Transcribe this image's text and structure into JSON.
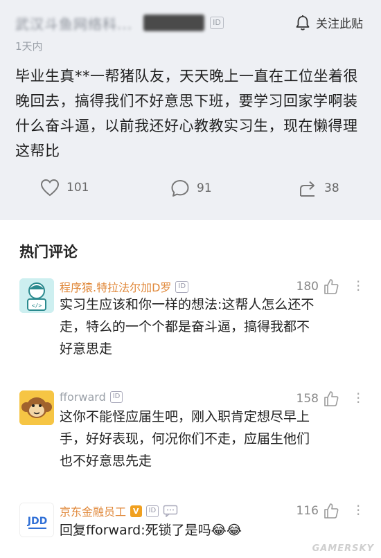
{
  "post": {
    "author_name": "武汉斗鱼网络科...",
    "author_badge": "",
    "id_label": "ID",
    "follow_label": "关注此贴",
    "time": "1天内",
    "body": "毕业生真**一帮猪队友，天天晚上一直在工位坐着很晚回去，搞得我们不好意思下班，要学习回家学啊装什么奋斗逼，以前我还好心教教实习生，现在懒得理这帮比",
    "likes": "101",
    "comments": "91",
    "shares": "38"
  },
  "section_title": "热门评论",
  "comments": [
    {
      "name": "程序猿.特拉法尔加D罗",
      "name_color": "#e0883a",
      "id_label": "ID",
      "likes": "180",
      "body": "实习生应该和你一样的想法:这帮人怎么还不走，特么的一个个都是奋斗逼，搞得我都不好意思走",
      "avatar_icon": "programmer-avatar-icon"
    },
    {
      "name": "fforward",
      "name_color": "#9aa0a8",
      "id_label": "ID",
      "likes": "158",
      "body": "这你不能怪应届生吧，刚入职肯定想尽早上手，好好表现，何况你们不走，应届生他们也不好意思先走",
      "avatar_icon": "monkey-avatar-icon"
    },
    {
      "name": "京东金融员工",
      "name_color": "#e0883a",
      "v_label": "V",
      "id_label": "ID",
      "likes": "116",
      "body": "回复fforward:死锁了是吗😂😂",
      "avatar_icon": "jdd-logo-icon",
      "avatar_text": "JDD"
    }
  ],
  "watermark": "GAMERSKY"
}
